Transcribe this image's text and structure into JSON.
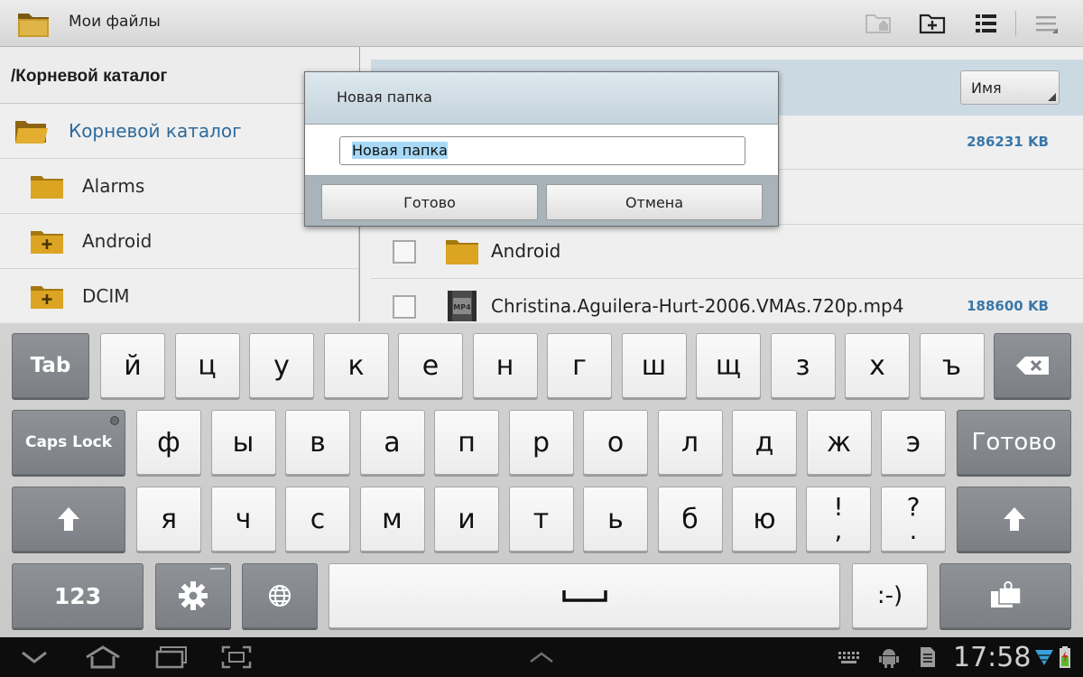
{
  "app": {
    "title": "Мои файлы"
  },
  "tree": {
    "path": "/Корневой каталог",
    "items": [
      {
        "label": "Корневой каталог"
      },
      {
        "label": "Alarms"
      },
      {
        "label": "Android"
      },
      {
        "label": "DCIM"
      }
    ]
  },
  "list": {
    "sort_label": "Имя",
    "rows": [
      {
        "name": "",
        "size": "286231 KB"
      },
      {
        "name": "Android",
        "size": ""
      },
      {
        "name": "Christina.Aguilera-Hurt-2006.VMAs.720p.mp4",
        "size": "188600 KB"
      }
    ]
  },
  "dialog": {
    "title": "Новая папка",
    "input_value": "Новая папка",
    "ok_label": "Готово",
    "cancel_label": "Отмена"
  },
  "keyboard": {
    "tab": "Tab",
    "caps_lock": "Caps Lock",
    "done": "Готово",
    "num_mode": "123",
    "smiley": ":-)",
    "row1": [
      "й",
      "ц",
      "у",
      "к",
      "е",
      "н",
      "г",
      "ш",
      "щ",
      "з",
      "х",
      "ъ"
    ],
    "row2": [
      "ф",
      "ы",
      "в",
      "а",
      "п",
      "р",
      "о",
      "л",
      "д",
      "ж",
      "э"
    ],
    "row3": [
      "я",
      "ч",
      "с",
      "м",
      "и",
      "т",
      "ь",
      "б",
      "ю"
    ],
    "punct1_top": "!",
    "punct1_bottom": ",",
    "punct2_top": "?",
    "punct2_bottom": "."
  },
  "status": {
    "time": "17:58"
  }
}
